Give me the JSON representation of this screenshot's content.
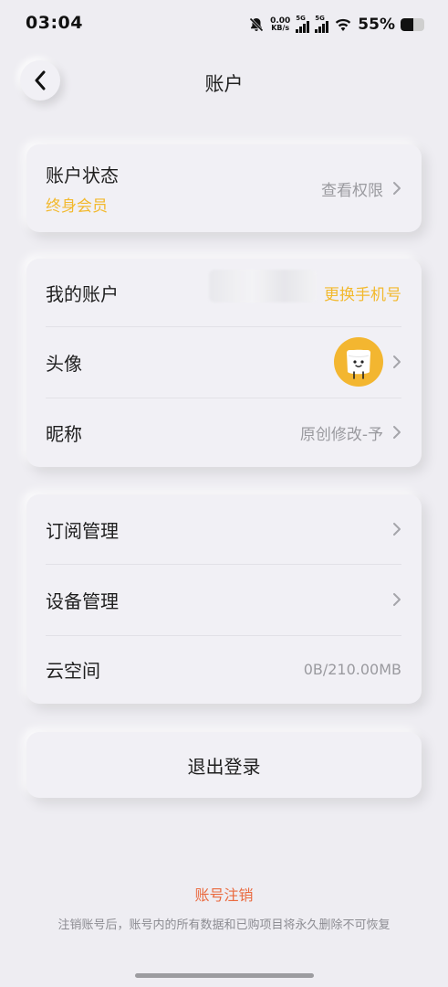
{
  "status_bar": {
    "time": "03:04",
    "net_speed_value": "0.00",
    "net_speed_unit": "KB/s",
    "sim1_tag": "5G",
    "sim2_tag": "5G",
    "battery_percent": "55%",
    "battery_level": 0.55
  },
  "nav": {
    "title": "账户",
    "back_icon": "chevron-left-icon"
  },
  "account_status": {
    "label": "账户状态",
    "value": "终身会员",
    "action": "查看权限"
  },
  "profile": {
    "my_account_label": "我的账户",
    "change_phone": "更换手机号",
    "avatar_label": "头像",
    "nickname_label": "昵称",
    "nickname_value": "原创修改-予"
  },
  "manage": {
    "subscription_label": "订阅管理",
    "device_label": "设备管理",
    "cloud_label": "云空间",
    "cloud_value": "0B/210.00MB"
  },
  "logout": {
    "label": "退出登录"
  },
  "footer": {
    "cancel_account": "账号注销",
    "cancel_note": "注销账号后，账号内的所有数据和已购项目将永久删除不可恢复"
  },
  "colors": {
    "accent": "#f2b92e",
    "danger": "#ea6a3f",
    "background": "#eeedf2"
  }
}
